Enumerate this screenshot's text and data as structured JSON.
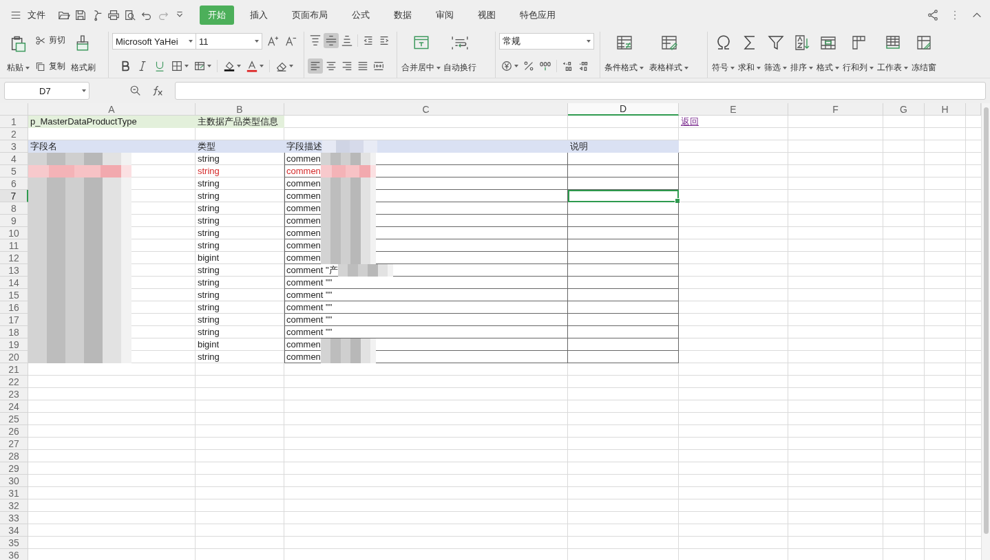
{
  "menu_button": {
    "label": "文件"
  },
  "tabs": [
    {
      "label": "开始",
      "selected": true
    },
    {
      "label": "插入",
      "selected": false
    },
    {
      "label": "页面布局",
      "selected": false
    },
    {
      "label": "公式",
      "selected": false
    },
    {
      "label": "数据",
      "selected": false
    },
    {
      "label": "审阅",
      "selected": false
    },
    {
      "label": "视图",
      "selected": false
    },
    {
      "label": "特色应用",
      "selected": false
    }
  ],
  "ribbon": {
    "paste": "粘贴",
    "cut": "剪切",
    "copy": "复制",
    "format_painter": "格式刷",
    "font_name": "Microsoft YaHei",
    "font_size": "11",
    "vertical_align": [
      {
        "kind": "top",
        "selected": false
      },
      {
        "kind": "middle",
        "selected": true
      },
      {
        "kind": "bottom",
        "selected": false
      }
    ],
    "horizontal_align": [
      {
        "kind": "left",
        "selected": true
      },
      {
        "kind": "center",
        "selected": false
      },
      {
        "kind": "right",
        "selected": false
      },
      {
        "kind": "justify",
        "selected": false
      },
      {
        "kind": "distributed",
        "selected": false
      }
    ],
    "merge": "合并居中",
    "wrap": "自动换行",
    "number_format": "常规",
    "style_tools": [
      {
        "kind": "conditional",
        "label": "条件格式",
        "dropdown": true
      },
      {
        "kind": "table-style",
        "label": "表格样式",
        "dropdown": true
      }
    ],
    "edit_tools": [
      {
        "kind": "symbol",
        "label": "符号",
        "dropdown": true
      },
      {
        "kind": "sum",
        "label": "求和",
        "dropdown": true
      },
      {
        "kind": "filter",
        "label": "筛选",
        "dropdown": true
      },
      {
        "kind": "sort",
        "label": "排序",
        "dropdown": true
      },
      {
        "kind": "format",
        "label": "格式",
        "dropdown": true
      },
      {
        "kind": "rows-cols",
        "label": "行和列",
        "dropdown": true
      },
      {
        "kind": "sheet",
        "label": "工作表",
        "dropdown": true
      },
      {
        "kind": "freeze",
        "label": "冻结窗",
        "dropdown": false
      }
    ]
  },
  "formula_bar": {
    "name_box": "D7"
  },
  "sheet": {
    "columns": [
      {
        "label": "A",
        "selected": false
      },
      {
        "label": "B",
        "selected": false
      },
      {
        "label": "C",
        "selected": false
      },
      {
        "label": "D",
        "selected": true
      },
      {
        "label": "E",
        "selected": false
      },
      {
        "label": "F",
        "selected": false
      },
      {
        "label": "G",
        "selected": false
      },
      {
        "label": "H",
        "selected": false
      }
    ],
    "rows": [
      {
        "number": "1",
        "selected": false,
        "flagged": false,
        "cells": [
          {
            "kind": "title",
            "text": "p_MasterDataProductType",
            "redacted": false
          },
          {
            "kind": "title",
            "text": "主数据产品类型信息",
            "redacted": false
          },
          {
            "kind": "blank"
          },
          {
            "kind": "blank"
          },
          {
            "kind": "link",
            "text": "返回",
            "redacted": false
          }
        ]
      },
      {
        "number": "2",
        "selected": false
      },
      {
        "number": "3",
        "selected": false,
        "flagged": false,
        "cells": [
          {
            "kind": "header",
            "text": "字段名",
            "redacted": false
          },
          {
            "kind": "header",
            "text": "类型",
            "redacted": false
          },
          {
            "kind": "header",
            "text": "字段描述",
            "redacted": true
          },
          {
            "kind": "header",
            "text": "说明",
            "redacted": false
          }
        ]
      },
      {
        "number": "4",
        "selected": false,
        "flagged": false,
        "cells": [
          {
            "kind": "data",
            "redacted": true
          },
          {
            "kind": "data",
            "text": "string",
            "redacted": false
          },
          {
            "kind": "boxed",
            "text": "commen",
            "redacted": true
          },
          {
            "kind": "boxed",
            "redacted": false
          }
        ]
      },
      {
        "number": "5",
        "selected": false,
        "flagged": true,
        "cells": [
          {
            "kind": "data",
            "redacted": true
          },
          {
            "kind": "data",
            "text": "string",
            "redacted": false
          },
          {
            "kind": "boxed",
            "text": "commen",
            "redacted": true
          },
          {
            "kind": "boxed",
            "redacted": false
          }
        ]
      },
      {
        "number": "6",
        "selected": false,
        "flagged": false,
        "cells": [
          {
            "kind": "data",
            "redacted": true
          },
          {
            "kind": "data",
            "text": "string",
            "redacted": false
          },
          {
            "kind": "boxed",
            "text": "commen",
            "redacted": true
          },
          {
            "kind": "boxed",
            "redacted": false
          }
        ]
      },
      {
        "number": "7",
        "selected": true,
        "flagged": false,
        "cells": [
          {
            "kind": "data",
            "redacted": true
          },
          {
            "kind": "data",
            "text": "string",
            "redacted": false
          },
          {
            "kind": "boxed",
            "text": "commen",
            "redacted": true
          },
          {
            "kind": "boxed",
            "redacted": false
          }
        ]
      },
      {
        "number": "8",
        "selected": false,
        "flagged": false,
        "cells": [
          {
            "kind": "data",
            "redacted": true
          },
          {
            "kind": "data",
            "text": "string",
            "redacted": false
          },
          {
            "kind": "boxed",
            "text": "commen",
            "redacted": true
          },
          {
            "kind": "boxed",
            "redacted": false
          }
        ]
      },
      {
        "number": "9",
        "selected": false,
        "flagged": false,
        "cells": [
          {
            "kind": "data",
            "redacted": true
          },
          {
            "kind": "data",
            "text": "string",
            "redacted": false
          },
          {
            "kind": "boxed",
            "text": "commen",
            "redacted": true
          },
          {
            "kind": "boxed",
            "redacted": false
          }
        ]
      },
      {
        "number": "10",
        "selected": false,
        "flagged": false,
        "cells": [
          {
            "kind": "data",
            "redacted": true
          },
          {
            "kind": "data",
            "text": "string",
            "redacted": false
          },
          {
            "kind": "boxed",
            "text": "commen",
            "redacted": true
          },
          {
            "kind": "boxed",
            "redacted": false
          }
        ]
      },
      {
        "number": "11",
        "selected": false,
        "flagged": false,
        "cells": [
          {
            "kind": "data",
            "redacted": true
          },
          {
            "kind": "data",
            "text": "string",
            "redacted": false
          },
          {
            "kind": "boxed",
            "text": "commen",
            "redacted": true
          },
          {
            "kind": "boxed",
            "redacted": false
          }
        ]
      },
      {
        "number": "12",
        "selected": false,
        "flagged": false,
        "cells": [
          {
            "kind": "data",
            "redacted": true
          },
          {
            "kind": "data",
            "text": "bigint",
            "redacted": false
          },
          {
            "kind": "boxed",
            "text": "commen",
            "redacted": true
          },
          {
            "kind": "boxed",
            "redacted": false
          }
        ]
      },
      {
        "number": "13",
        "selected": false,
        "flagged": false,
        "cells": [
          {
            "kind": "data",
            "redacted": true
          },
          {
            "kind": "data",
            "text": "string",
            "redacted": false
          },
          {
            "kind": "boxed",
            "text": "comment \"产",
            "redacted": true
          },
          {
            "kind": "boxed",
            "redacted": false
          }
        ]
      },
      {
        "number": "14",
        "selected": false,
        "flagged": false,
        "cells": [
          {
            "kind": "data",
            "redacted": true
          },
          {
            "kind": "data",
            "text": "string",
            "redacted": false
          },
          {
            "kind": "boxed",
            "text": "comment \"\"",
            "redacted": false
          },
          {
            "kind": "boxed",
            "redacted": false
          }
        ]
      },
      {
        "number": "15",
        "selected": false,
        "flagged": false,
        "cells": [
          {
            "kind": "data",
            "redacted": true
          },
          {
            "kind": "data",
            "text": "string",
            "redacted": false
          },
          {
            "kind": "boxed",
            "text": "comment \"\"",
            "redacted": false
          },
          {
            "kind": "boxed",
            "redacted": false
          }
        ]
      },
      {
        "number": "16",
        "selected": false,
        "flagged": false,
        "cells": [
          {
            "kind": "data",
            "redacted": true
          },
          {
            "kind": "data",
            "text": "string",
            "redacted": false
          },
          {
            "kind": "boxed",
            "text": "comment \"\"",
            "redacted": false
          },
          {
            "kind": "boxed",
            "redacted": false
          }
        ]
      },
      {
        "number": "17",
        "selected": false,
        "flagged": false,
        "cells": [
          {
            "kind": "data",
            "redacted": true
          },
          {
            "kind": "data",
            "text": "string",
            "redacted": false
          },
          {
            "kind": "boxed",
            "text": "comment \"\"",
            "redacted": false
          },
          {
            "kind": "boxed",
            "redacted": false
          }
        ]
      },
      {
        "number": "18",
        "selected": false,
        "flagged": false,
        "cells": [
          {
            "kind": "data",
            "redacted": true
          },
          {
            "kind": "data",
            "text": "string",
            "redacted": false
          },
          {
            "kind": "boxed",
            "text": "comment \"\"",
            "redacted": false
          },
          {
            "kind": "boxed",
            "redacted": false
          }
        ]
      },
      {
        "number": "19",
        "selected": false,
        "flagged": false,
        "cells": [
          {
            "kind": "data",
            "redacted": true
          },
          {
            "kind": "data",
            "text": "bigint",
            "redacted": false
          },
          {
            "kind": "boxed",
            "text": "commen",
            "redacted": true
          },
          {
            "kind": "boxed",
            "redacted": false
          }
        ]
      },
      {
        "number": "20",
        "selected": false,
        "flagged": false,
        "cells": [
          {
            "kind": "data",
            "redacted": true
          },
          {
            "kind": "data",
            "text": "string",
            "redacted": false
          },
          {
            "kind": "boxed",
            "text": "commen",
            "redacted": true
          },
          {
            "kind": "boxed",
            "redacted": false
          }
        ]
      },
      {
        "number": "21",
        "selected": false
      },
      {
        "number": "22",
        "selected": false
      },
      {
        "number": "23",
        "selected": false
      },
      {
        "number": "24",
        "selected": false
      },
      {
        "number": "25",
        "selected": false
      },
      {
        "number": "26",
        "selected": false
      },
      {
        "number": "27",
        "selected": false
      },
      {
        "number": "28",
        "selected": false
      },
      {
        "number": "29",
        "selected": false
      },
      {
        "number": "30",
        "selected": false
      },
      {
        "number": "31",
        "selected": false
      },
      {
        "number": "32",
        "selected": false
      },
      {
        "number": "33",
        "selected": false
      },
      {
        "number": "34",
        "selected": false
      },
      {
        "number": "35",
        "selected": false
      },
      {
        "number": "36",
        "selected": false
      }
    ]
  }
}
